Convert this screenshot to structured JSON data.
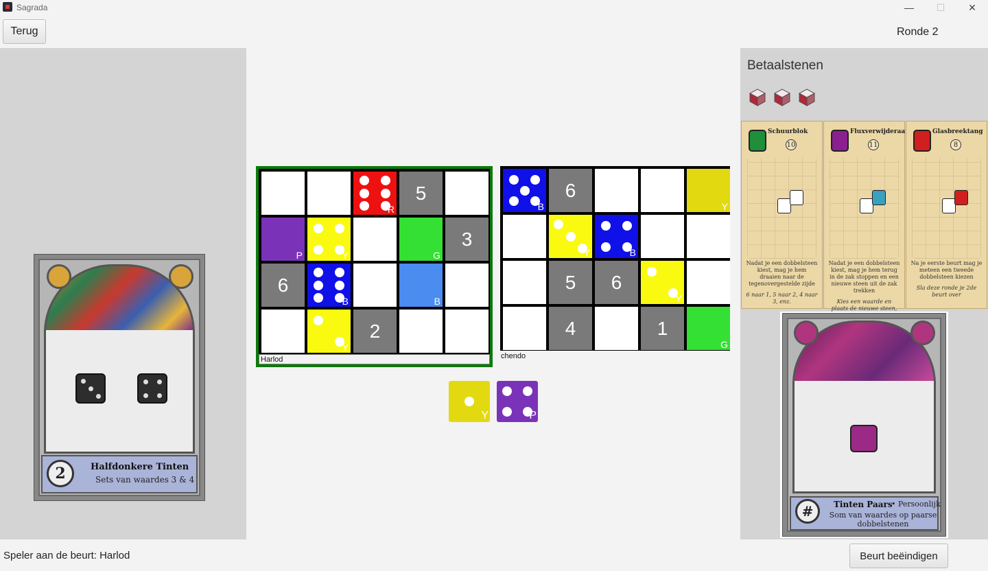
{
  "window": {
    "title": "Sagrada",
    "minimize_glyph": "—",
    "maximize_glyph": "☐",
    "close_glyph": "✕"
  },
  "toolbar": {
    "back_label": "Terug",
    "round_label": "Ronde 2"
  },
  "public_objective": {
    "value": "2",
    "title": "Halfdonkere Tinten",
    "subtitle": "Sets van waardes 3 & 4"
  },
  "boards": [
    {
      "player": "Harlod",
      "active": true,
      "cells": [
        [
          {
            "bg": "#ffffff"
          },
          {
            "bg": "#ffffff"
          },
          {
            "bg": "#ee1111",
            "pips": 6,
            "label": "R"
          },
          {
            "bg": "#7a7a7a",
            "num": "5"
          },
          {
            "bg": "#ffffff"
          }
        ],
        [
          {
            "bg": "#7a33b8",
            "label": "P"
          },
          {
            "bg": "#fafa10",
            "pips": 4,
            "label": "Y"
          },
          {
            "bg": "#ffffff"
          },
          {
            "bg": "#33e033",
            "label": "G"
          },
          {
            "bg": "#7a7a7a",
            "num": "3"
          }
        ],
        [
          {
            "bg": "#7a7a7a",
            "num": "6"
          },
          {
            "bg": "#1010e8",
            "pips": 6,
            "label": "B"
          },
          {
            "bg": "#ffffff"
          },
          {
            "bg": "#4a8cf0",
            "label": "B"
          },
          {
            "bg": "#ffffff"
          }
        ],
        [
          {
            "bg": "#ffffff"
          },
          {
            "bg": "#fafa10",
            "pips": 2,
            "label": "Y"
          },
          {
            "bg": "#7a7a7a",
            "num": "2"
          },
          {
            "bg": "#ffffff"
          },
          {
            "bg": "#ffffff"
          }
        ]
      ]
    },
    {
      "player": "chendo",
      "active": false,
      "cells": [
        [
          {
            "bg": "#1010e8",
            "pips": 5,
            "label": "B"
          },
          {
            "bg": "#7a7a7a",
            "num": "6"
          },
          {
            "bg": "#ffffff"
          },
          {
            "bg": "#ffffff"
          },
          {
            "bg": "#e3d910",
            "label": "Y"
          }
        ],
        [
          {
            "bg": "#ffffff"
          },
          {
            "bg": "#fafa10",
            "pips": 3,
            "label": "Y"
          },
          {
            "bg": "#1010e8",
            "pips": 4,
            "label": "B"
          },
          {
            "bg": "#ffffff"
          },
          {
            "bg": "#ffffff"
          }
        ],
        [
          {
            "bg": "#ffffff"
          },
          {
            "bg": "#7a7a7a",
            "num": "5"
          },
          {
            "bg": "#7a7a7a",
            "num": "6"
          },
          {
            "bg": "#fafa10",
            "pips": 2,
            "label": "Y"
          },
          {
            "bg": "#ffffff"
          }
        ],
        [
          {
            "bg": "#ffffff"
          },
          {
            "bg": "#7a7a7a",
            "num": "4"
          },
          {
            "bg": "#ffffff"
          },
          {
            "bg": "#7a7a7a",
            "num": "1"
          },
          {
            "bg": "#33e033",
            "label": "G"
          }
        ]
      ]
    }
  ],
  "draft_pool": [
    {
      "bg": "#e3d910",
      "pips": 1,
      "label": "Y"
    },
    {
      "bg": "#7a33b8",
      "pips": 4,
      "label": "P"
    }
  ],
  "tokens": {
    "title": "Betaalstenen",
    "count": 3,
    "color": "#b0283a"
  },
  "tool_cards": [
    {
      "title": "Schuurblok",
      "cost": "10",
      "color": "#1f8f3a",
      "desc_top": "Nadat je een dobbelsteen kiest, mag je hem draaien naar de tegenovergestelde zijde",
      "desc_bottom": "6 naar 1, 5 naar 2, 4 naar 3, enz."
    },
    {
      "title": "Fluxverwijderaar",
      "cost": "11",
      "color": "#8a1f8f",
      "desc_top": "Nadat je een dobbelsteen kiest, mag je hem terug in de zak stoppen en een nieuwe steen uit de zak trekken",
      "desc_bottom": "Kies een waarde en plaats de nieuwe steen, of leg hem in het Aanbod"
    },
    {
      "title": "Glasbreektang",
      "cost": "8",
      "color": "#d11f1f",
      "desc_top": "Na je eerste beurt mag je meteen een tweede dobbelsteen kiezen",
      "desc_bottom": "Sla deze ronde je 2de beurt over"
    }
  ],
  "private_objective": {
    "title": "Tinten Paars",
    "tag": "• Persoonlijk",
    "subtitle": "Som van waardes op paarse dobbelstenen",
    "symbol": "#",
    "color": "#9a2a86"
  },
  "status": {
    "current_player": "Speler aan de beurt: Harlod",
    "end_turn_label": "Beurt beëindigen"
  }
}
